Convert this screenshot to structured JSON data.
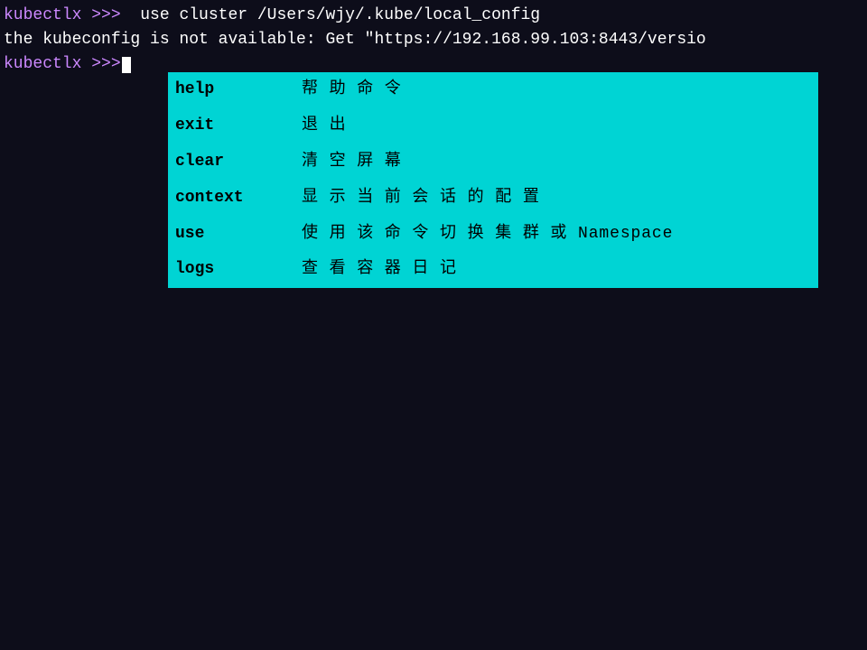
{
  "terminal": {
    "background": "#0d0d1a",
    "lines": [
      {
        "prompt": "kubectlx >>>",
        "command": " use cluster /Users/wjy/.kube/local_config"
      }
    ],
    "error_line": "the kubeconfig is not available: Get \"https://192.168.99.103:8443/versio",
    "prompt_label": "kubectlx >>>",
    "prompt_color": "#cc88ff"
  },
  "autocomplete": {
    "items": [
      {
        "cmd": "help",
        "desc": "帮 助 命 令"
      },
      {
        "cmd": "exit",
        "desc": "退 出"
      },
      {
        "cmd": "clear",
        "desc": "清 空 屏 幕"
      },
      {
        "cmd": "context",
        "desc": "显 示 当 前 会 话 的 配 置"
      },
      {
        "cmd": "use",
        "desc": "使 用 该 命 令 切 换 集 群 或 Namespace"
      },
      {
        "cmd": "logs",
        "desc": "查 看 容 器 日 记"
      }
    ],
    "bg_color": "#00d4d4"
  }
}
